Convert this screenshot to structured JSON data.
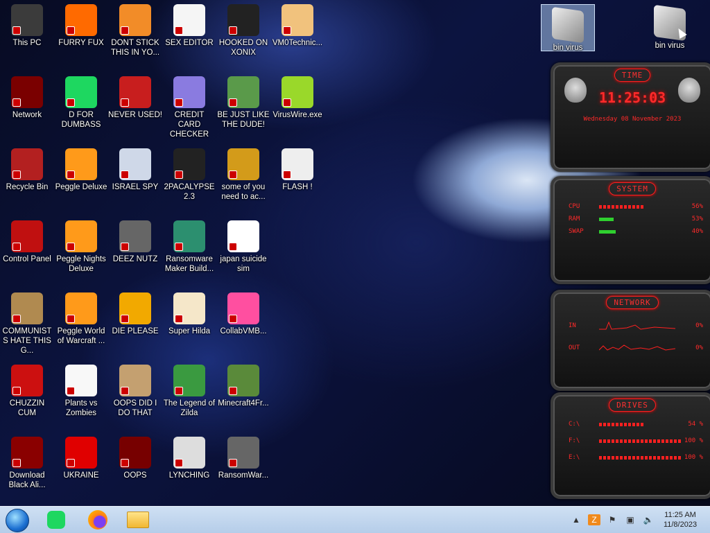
{
  "desktop_icons": [
    {
      "label": "This PC"
    },
    {
      "label": "FURRY FUX"
    },
    {
      "label": "DONT STICK THIS IN YO..."
    },
    {
      "label": "SEX EDITOR"
    },
    {
      "label": "HOOKED ON XONIX"
    },
    {
      "label": "VM0Technic..."
    },
    {
      "label": "Network"
    },
    {
      "label": "D FOR DUMBASS"
    },
    {
      "label": "NEVER USED!"
    },
    {
      "label": "CREDIT CARD CHECKER"
    },
    {
      "label": "BE JUST LIKE THE DUDE!"
    },
    {
      "label": "VirusWire.exe"
    },
    {
      "label": "Recycle Bin"
    },
    {
      "label": "Peggle Deluxe"
    },
    {
      "label": "ISRAEL SPY"
    },
    {
      "label": "2PACALYPSE 2.3"
    },
    {
      "label": "some of you need to ac..."
    },
    {
      "label": "FLASH !"
    },
    {
      "label": "Control Panel"
    },
    {
      "label": "Peggle Nights Deluxe"
    },
    {
      "label": "DEEZ NUTZ"
    },
    {
      "label": "Ransomware Maker Build..."
    },
    {
      "label": "japan suicide sim"
    },
    {
      "label": "COMMUNISTS HATE THIS G..."
    },
    {
      "label": "Peggle World of Warcraft ..."
    },
    {
      "label": "DIE PLEASE"
    },
    {
      "label": "Super Hilda"
    },
    {
      "label": "CollabVMB..."
    },
    {
      "label": "CHUZZIN CUM"
    },
    {
      "label": "Plants vs Zombies"
    },
    {
      "label": "OOPS DID I DO THAT"
    },
    {
      "label": "The Legend of Zilda"
    },
    {
      "label": "Minecraft4Fr..."
    },
    {
      "label": "Download Black Ali..."
    },
    {
      "label": "UKRAINE"
    },
    {
      "label": "OOPS"
    },
    {
      "label": "LYNCHING"
    },
    {
      "label": "RansomWar..."
    }
  ],
  "top_right_icons": [
    {
      "label": "bin virus"
    },
    {
      "label": "bin virus"
    }
  ],
  "gadgets": {
    "time": {
      "title": "TIME",
      "clock": "11:25:03",
      "date": "Wednesday 08 November 2023"
    },
    "system": {
      "title": "SYSTEM",
      "rows": [
        {
          "name": "CPU",
          "pct": "56%",
          "level": 0.56
        },
        {
          "name": "RAM",
          "pct": "53%",
          "level": 0.18
        },
        {
          "name": "SWAP",
          "pct": "40%",
          "level": 0.2
        }
      ]
    },
    "network": {
      "title": "NETWORK",
      "rows": [
        {
          "name": "IN",
          "pct": "0%"
        },
        {
          "name": "OUT",
          "pct": "0%"
        }
      ]
    },
    "drives": {
      "title": "DRIVES",
      "rows": [
        {
          "name": "C:\\",
          "pct": "54 %",
          "level": 0.54
        },
        {
          "name": "F:\\",
          "pct": "100 %",
          "level": 1.0
        },
        {
          "name": "E:\\",
          "pct": "100 %",
          "level": 1.0
        }
      ]
    }
  },
  "taskbar": {
    "clock_time": "11:25 AM",
    "clock_date": "11/8/2023"
  }
}
